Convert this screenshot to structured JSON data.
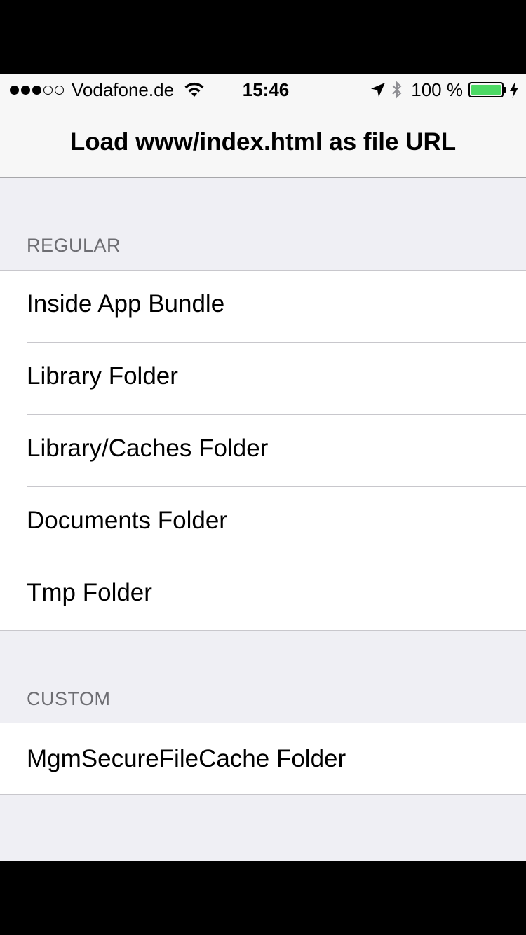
{
  "status_bar": {
    "signal_dots_filled": 3,
    "signal_dots_total": 5,
    "carrier": "Vodafone.de",
    "time": "15:46",
    "battery_percent_label": "100 %",
    "battery_level": 1.0,
    "battery_color": "#4cd964",
    "icons": [
      "wifi-icon",
      "location-arrow-icon",
      "bluetooth-icon",
      "battery-icon",
      "charging-bolt-icon"
    ]
  },
  "nav": {
    "title": "Load www/index.html as file URL"
  },
  "sections": [
    {
      "header": "REGULAR",
      "items": [
        {
          "label": "Inside App Bundle"
        },
        {
          "label": "Library Folder"
        },
        {
          "label": "Library/Caches Folder"
        },
        {
          "label": "Documents Folder"
        },
        {
          "label": "Tmp Folder"
        }
      ]
    },
    {
      "header": "CUSTOM",
      "items": [
        {
          "label": "MgmSecureFileCache Folder"
        }
      ]
    }
  ]
}
